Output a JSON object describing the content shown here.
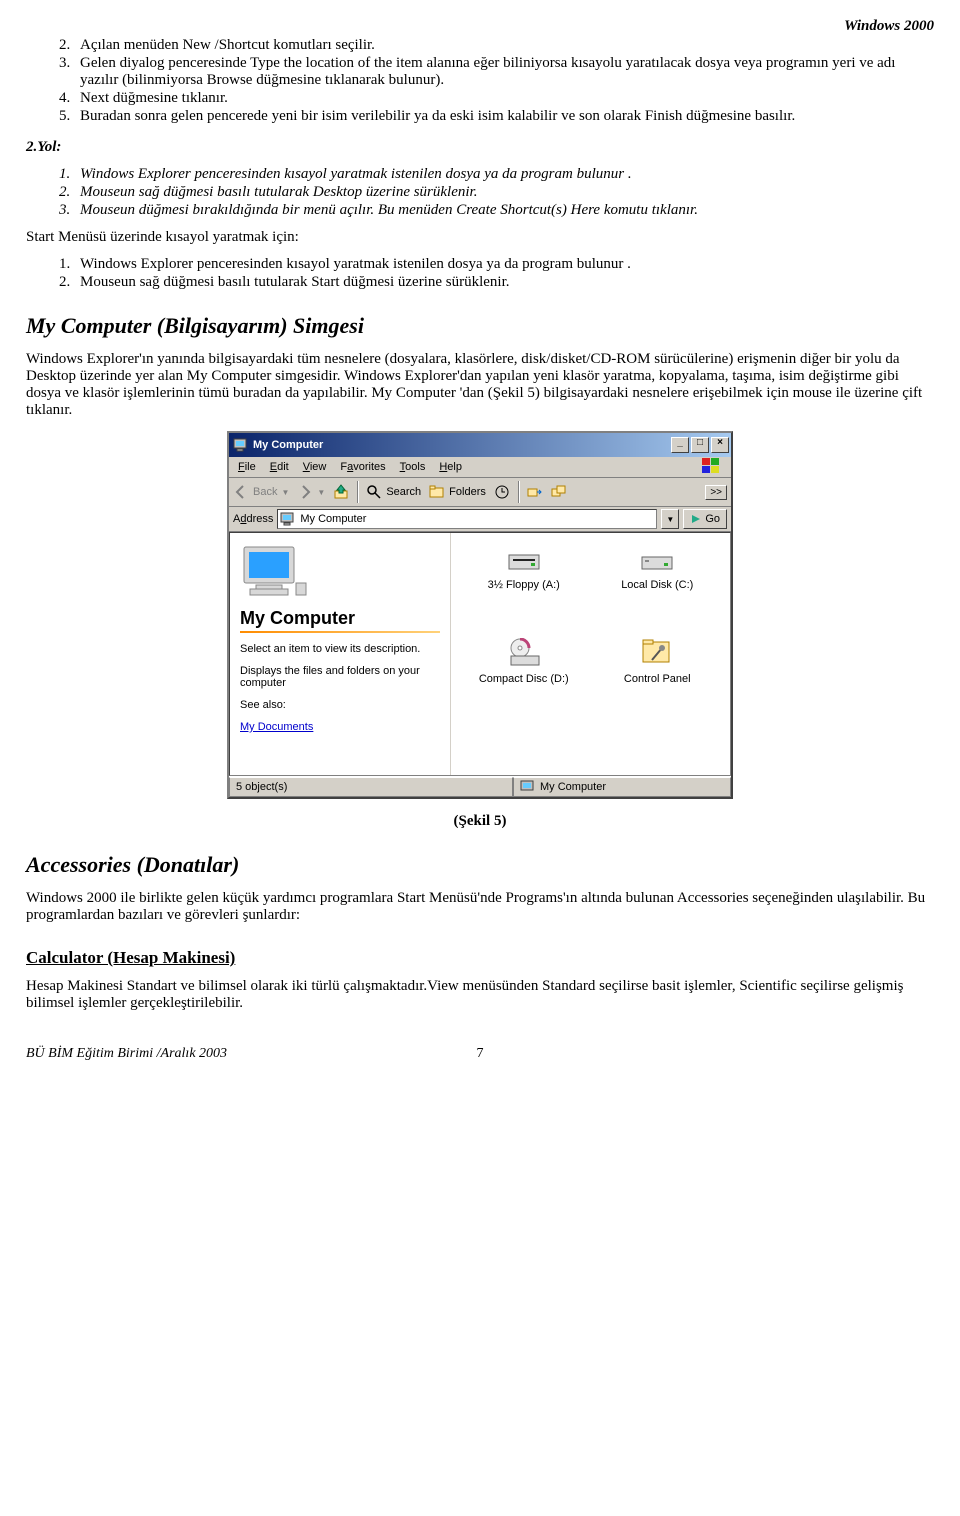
{
  "header": {
    "product": "Windows 2000"
  },
  "list1": {
    "i2": "Açılan menüden  New /Shortcut komutları seçilir.",
    "i3": "Gelen diyalog penceresinde  Type the location of the item alanına eğer biliniyorsa kısayolu yaratılacak dosya veya programın yeri ve adı yazılır (bilinmiyorsa Browse düğmesine tıklanarak bulunur).",
    "i4": "Next düğmesine tıklanır.",
    "i5": "Buradan sonra gelen pencerede yeni bir isim verilebilir ya da eski isim  kalabilir ve son olarak Finish düğmesine basılır."
  },
  "yol_label": "2.Yol:",
  "list2": {
    "i1": "Windows Explorer penceresinden kısayol yaratmak istenilen dosya ya da program bulunur .",
    "i2": "Mouseun sağ düğmesi basılı tutularak Desktop üzerine sürüklenir.",
    "i3": "Mouseun düğmesi bırakıldığında bir menü açılır. Bu menüden Create Shortcut(s) Here komutu tıklanır."
  },
  "start_intro": "Start Menüsü üzerinde kısayol yaratmak için:",
  "list3": {
    "i1": "Windows Explorer penceresinden kısayol yaratmak istenilen dosya ya da program bulunur .",
    "i2": "Mouseun sağ düğmesi basılı tutularak Start düğmesi üzerine sürüklenir."
  },
  "section_mycomp": "My Computer (Bilgisayarım) Simgesi",
  "paragraph_mycomp": "Windows Explorer'ın yanında bilgisayardaki tüm nesnelere (dosyalara, klasörlere, disk/disket/CD-ROM sürücülerine) erişmenin diğer bir  yolu da Desktop üzerinde yer alan My Computer  simgesidir. Windows Explorer'dan yapılan yeni klasör yaratma, kopyalama, taşıma, isim değiştirme gibi dosya ve klasör işlemlerinin tümü  buradan da yapılabilir. My Computer 'dan  (Şekil 5) bilgisayardaki nesnelere erişebilmek için mouse ile üzerine çift tıklanır.",
  "caption5": "(Şekil 5)",
  "section_acc": "Accessories (Donatılar)",
  "paragraph_acc": "Windows 2000 ile birlikte gelen küçük yardımcı  programlara  Start Menüsü'nde Programs'ın altında bulunan Accessories seçeneğinden ulaşılabilir.  Bu programlardan bazıları ve görevleri şunlardır:",
  "section_calc": "Calculator (Hesap Makinesi)",
  "paragraph_calc": "Hesap Makinesi Standart ve bilimsel olarak iki türlü çalışmaktadır.View menüsünden Standard seçilirse basit işlemler, Scientific  seçilirse gelişmiş bilimsel işlemler gerçekleştirilebilir.",
  "footer": {
    "left": "BÜ BİM Eğitim Birimi /Aralık 2003",
    "page": "7"
  },
  "window": {
    "title": "My Computer",
    "menus": {
      "file": "File",
      "edit": "Edit",
      "view": "View",
      "fav": "Favorites",
      "tools": "Tools",
      "help": "Help"
    },
    "toolbar": {
      "back": "Back",
      "search": "Search",
      "folders": "Folders",
      "chev": ">>"
    },
    "address": {
      "label": "Address",
      "value": "My Computer",
      "go": "Go"
    },
    "leftpane": {
      "heading": "My Computer",
      "tip": "Select an item to view its description.",
      "desc": "Displays the files and folders on your computer",
      "see": "See also:",
      "link": "My Documents"
    },
    "icons": {
      "floppy": "3½ Floppy (A:)",
      "hdd": "Local Disk (C:)",
      "cd": "Compact Disc (D:)",
      "cpl": "Control Panel"
    },
    "status": {
      "left": "5 object(s)",
      "right": "My Computer"
    }
  }
}
